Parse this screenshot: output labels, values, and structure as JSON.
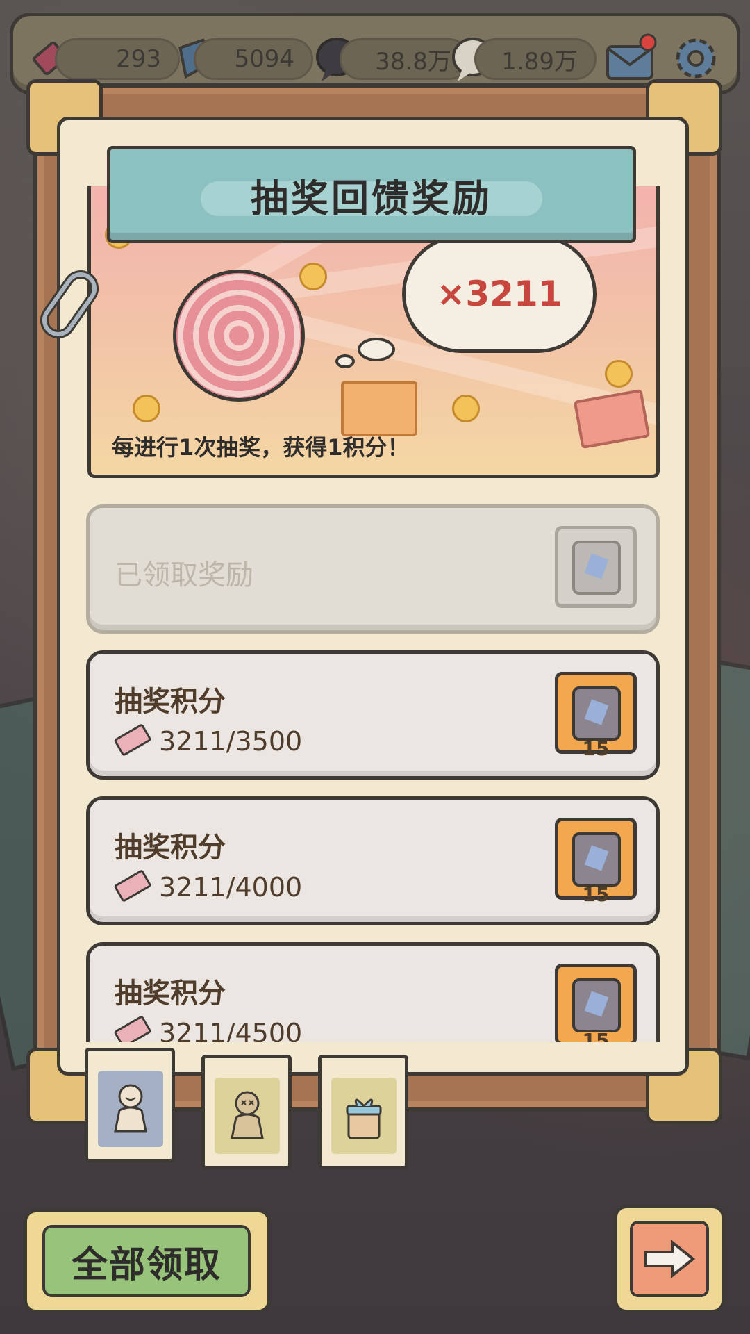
{
  "topbar": {
    "tickets": "293",
    "gems": "5094",
    "currency_a": "38.8万",
    "currency_b": "1.89万",
    "icons": [
      "ticket-icon",
      "gem-icon",
      "dark-bubble-icon",
      "light-bubble-icon",
      "mail-icon",
      "settings-icon"
    ]
  },
  "panel": {
    "title": "抽奖回馈奖励",
    "multiplier": "×3211",
    "description": "每进行1次抽奖，获得1积分！"
  },
  "rewards": {
    "claimed_label": "已领取奖励",
    "items": [
      {
        "title": "抽奖积分",
        "progress": "3211/3500",
        "count": "15"
      },
      {
        "title": "抽奖积分",
        "progress": "3211/4000",
        "count": "15"
      },
      {
        "title": "抽奖积分",
        "progress": "3211/4500",
        "count": "15"
      }
    ]
  },
  "tabs": [
    {
      "name": "doll-tab",
      "active": true
    },
    {
      "name": "voodoo-tab",
      "active": false
    },
    {
      "name": "gift-tab",
      "active": false
    }
  ],
  "buttons": {
    "claim_all": "全部领取"
  },
  "colors": {
    "accent_teal": "#8bc1c0",
    "claim_green": "#98c37a",
    "reward_orange": "#f3a74f",
    "multiplier_red": "#c7473f"
  }
}
